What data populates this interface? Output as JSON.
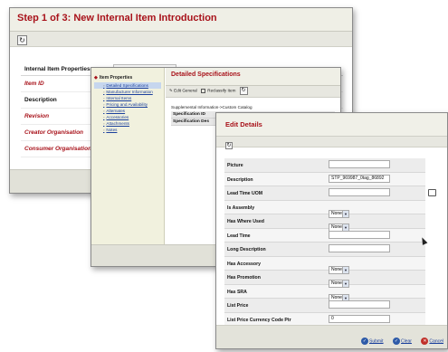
{
  "window1": {
    "title": "Step 1 of 3: New Internal Item Introduction",
    "section_title": "Internal Item Properties",
    "fields": [
      {
        "label": "Item ID",
        "style": "red"
      },
      {
        "label": "Description",
        "style": "black"
      },
      {
        "label": "Revision",
        "style": "red"
      },
      {
        "label": "Creator Organisation",
        "style": "red"
      },
      {
        "label": "Consumer Organisation",
        "style": "red"
      }
    ]
  },
  "window2": {
    "tree_title": "Item Properties",
    "tree_items": [
      "Detailed Specifications",
      "Manufacturer Information",
      "Internal Items",
      "Pricing and Availability",
      "Alternates",
      "Accessories",
      "Attachments",
      "Notes"
    ],
    "selected_index": 0,
    "panel_title": "Detailed Specifications",
    "toolbar": {
      "edit_general": "Edit General",
      "reclassify": "Reclassify Item"
    },
    "breadcrumb": "Supplemental Information->Custom Catalog",
    "spec_rows": [
      "Specification ID",
      "Specification Des"
    ]
  },
  "window3": {
    "title": "Edit Details",
    "rows": [
      {
        "label": "Picture",
        "kind": "text",
        "value": ""
      },
      {
        "label": "Description",
        "kind": "text",
        "value": "STP_969987_0tag_86892"
      },
      {
        "label": "Lead Time UOM",
        "kind": "text",
        "value": ""
      },
      {
        "label": "Is Assembly",
        "kind": "select",
        "value": "None"
      },
      {
        "label": "Has Where Used",
        "kind": "select",
        "value": "None"
      },
      {
        "label": "Lead Time",
        "kind": "text",
        "value": ""
      },
      {
        "label": "Long Description",
        "kind": "text",
        "value": ""
      },
      {
        "label": "Has Accessory",
        "kind": "select",
        "value": "None"
      },
      {
        "label": "Has Promotion",
        "kind": "select",
        "value": "None"
      },
      {
        "label": "Has SRA",
        "kind": "select",
        "value": "None"
      },
      {
        "label": "List Price",
        "kind": "text",
        "value": ""
      },
      {
        "label": "List Price Currency Code Ptr",
        "kind": "text",
        "value": "0"
      }
    ],
    "footer": {
      "submit": "Submit",
      "clear": "Clear",
      "cancel": "Cancel"
    }
  },
  "colors": {
    "title_red": "#a8121a",
    "link_blue": "#1a3f9c",
    "panel_beige": "#efefe6"
  }
}
